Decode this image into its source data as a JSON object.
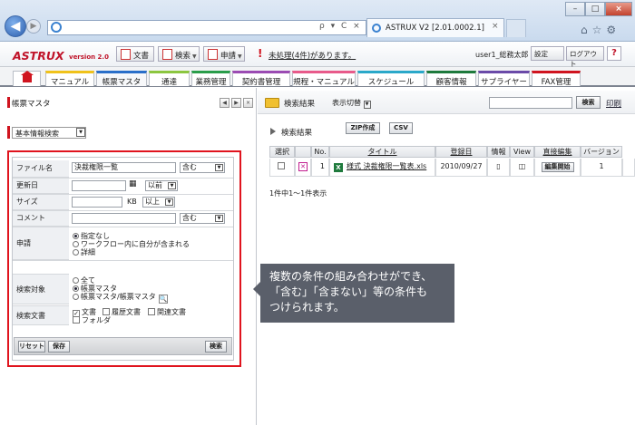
{
  "browser": {
    "tab_title": "ASTRUX V2 [2.01.0002.1]",
    "tab_close": "×",
    "win_min": "–",
    "win_max": "□",
    "win_close": "×",
    "addr_tools": "ρ ▾ C ×",
    "icons": "⌂☆⚙"
  },
  "app": {
    "logo": "ASTRUX",
    "version": "version 2.0",
    "btn_doc": "文書",
    "btn_search": "検索",
    "btn_apply": "申請",
    "warn_mark": "!",
    "pending": "未処理(4件)があります。",
    "user": "user1_総務太郎",
    "settings": "設定",
    "logout": "ログアウト",
    "help": "?"
  },
  "nav": {
    "tabs": [
      "マニュアル",
      "帳票マスタ",
      "通達",
      "業務管理",
      "契約書管理",
      "規程・マニュアル",
      "スケジュール",
      "顧客情報",
      "サプライヤー",
      "FAX管理"
    ],
    "colors": [
      "#f0c21a",
      "#2a6fc9",
      "#8cc63f",
      "#2a9d4a",
      "#9b4bb3",
      "#e85a8a",
      "#2aa8c9",
      "#1e7a3c",
      "#6a4aa8",
      "#d0141f"
    ]
  },
  "left": {
    "title": "帳票マスタ",
    "basic_search": "基本情報検索",
    "labels": {
      "filename": "ファイル名",
      "updated": "更新日",
      "size": "サイズ",
      "comment": "コメント",
      "apply": "申請",
      "target": "検索対象",
      "doctype": "検索文書"
    },
    "filename_value": "決裁権限一覧",
    "contains": "含む",
    "before": "以前",
    "kb": "KB",
    "over": "以上",
    "apply_opts": [
      "指定なし",
      "ワークフロー内に自分が含まれる",
      "詳細"
    ],
    "target_opts": [
      "全て",
      "帳票マスタ",
      "帳票マスタ/帳票マスタ"
    ],
    "doc_opts": [
      "文書",
      "履歴文書",
      "関連文書",
      "フォルダ"
    ],
    "reset": "リセット",
    "save": "保存",
    "search": "検索"
  },
  "right": {
    "title": "検索結果",
    "view_switch": "表示切替",
    "search_btn": "検索",
    "print": "印刷",
    "results_label": "検索結果",
    "zip": "ZIP作成",
    "csv": "CSV",
    "headers": [
      "選択",
      "",
      "No.",
      "タイトル",
      "登録日",
      "情報",
      "View",
      "直接編集",
      "バージョン"
    ],
    "row": {
      "no": "1",
      "title": "様式 決裁権限一覧表.xls",
      "date": "2010/09/27",
      "edit_btn": "編集開始",
      "version": "1"
    },
    "count": "1件中1〜1件表示"
  },
  "callout": {
    "line1": "複数の条件の組み合わせができ、",
    "line2": "「含む」「含まない」等の条件も",
    "line3": "つけられます。"
  }
}
